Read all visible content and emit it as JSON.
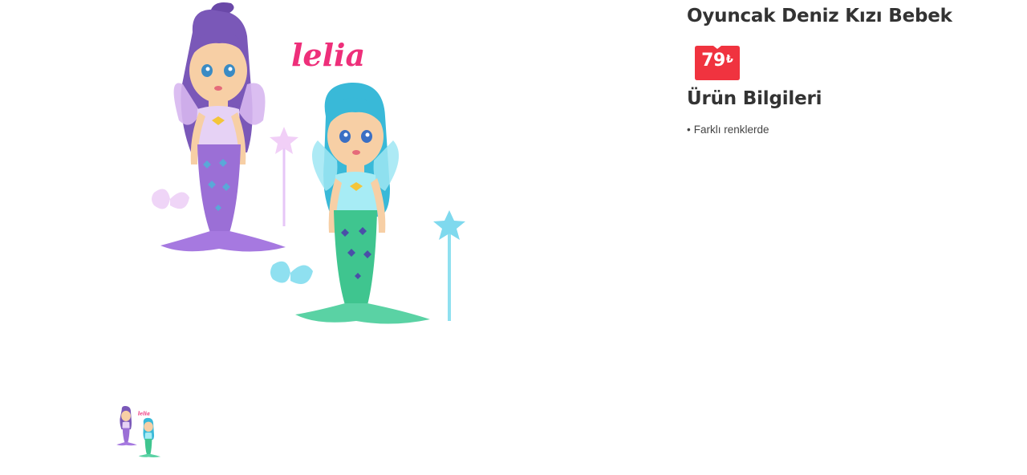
{
  "product": {
    "title": "Oyuncak Deniz Kızı Bebek",
    "price": {
      "value": "79",
      "currency": "₺",
      "badge_color": "#f0333f"
    },
    "main_image": {
      "description_icon": "mermaid-dolls-photo",
      "logo_text": "lelia",
      "logo_color": "#ee2f7a"
    },
    "thumbnails": [
      {
        "icon": "mermaid-dolls-thumbnail"
      }
    ]
  },
  "info": {
    "heading": "Ürün Bilgileri",
    "bullet_symbol": "•",
    "features": [
      "Farklı renklerde"
    ]
  },
  "colors": {
    "text": "#333333",
    "purple_tail": "#9b6fd6",
    "green_tail": "#3fc58f",
    "teal_hair": "#39b9d8",
    "purple_hair": "#7a58b8"
  }
}
